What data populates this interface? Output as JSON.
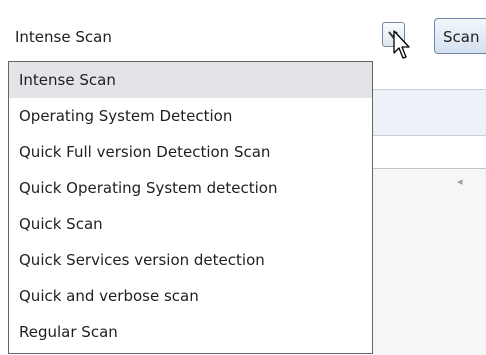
{
  "combo": {
    "value": "Intense Scan"
  },
  "scan_button": {
    "label": "Scan"
  },
  "dropdown": {
    "items": [
      "Intense Scan",
      "Operating System Detection",
      "Quick Full version Detection Scan",
      "Quick Operating System detection",
      "Quick Scan",
      "Quick Services version detection",
      "Quick and verbose scan",
      "Regular Scan"
    ],
    "selected_index": 0
  },
  "icons": {
    "combo_arrow": "chevron-down-icon",
    "pointer": "mouse-cursor-icon",
    "scroll": "scroll-left-arrow-icon"
  }
}
